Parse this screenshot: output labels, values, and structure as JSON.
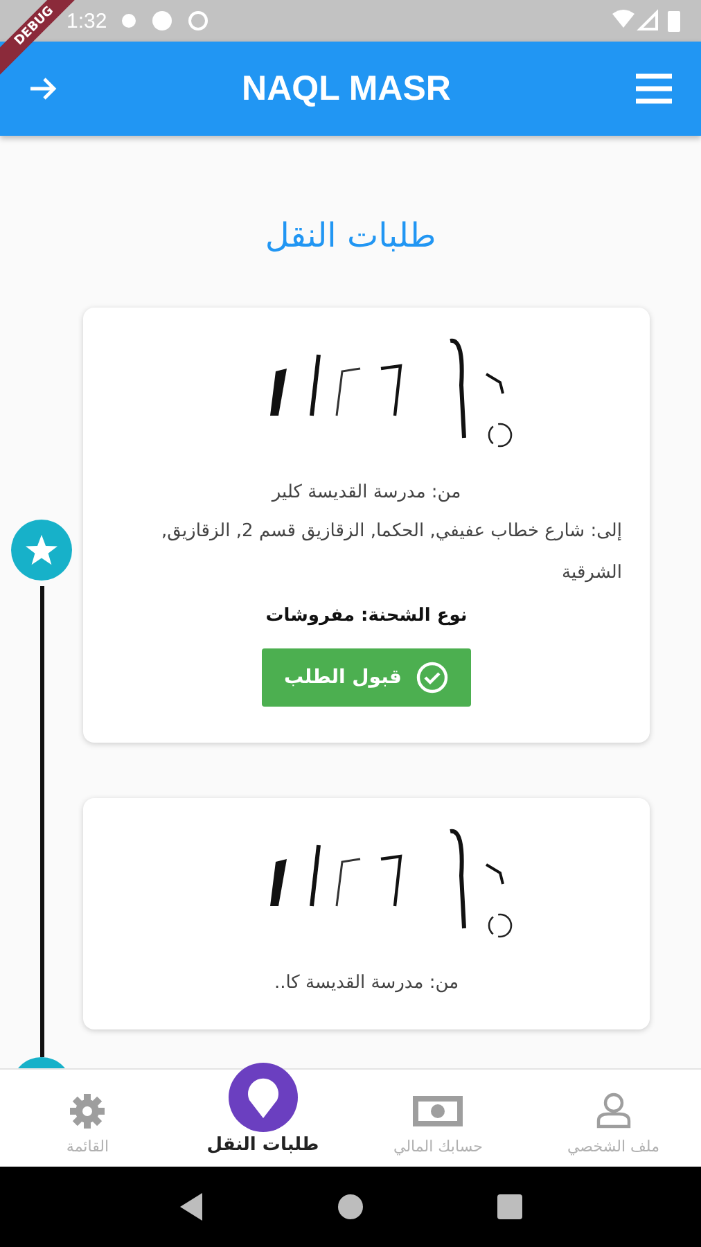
{
  "status_bar": {
    "time": "1:32"
  },
  "debug_banner": "DEBUG",
  "app_bar": {
    "title": "NAQL MASR"
  },
  "page_title": "طلبات النقل",
  "requests": [
    {
      "from": "من: مدرسة القديسة كلير",
      "to": "إلى: شارع خطاب عفيفي, الحكما, الزقازيق قسم 2, الزقازيق, الشرقية",
      "cargo": "نوع الشحنة: مفروشات",
      "accept_button": "قبول الطلب"
    },
    {
      "from": "من: مدرسة القديسة كا.."
    }
  ],
  "bottom_nav": [
    {
      "kind": "profile",
      "label": "ملف الشخصي",
      "selected": false
    },
    {
      "kind": "account",
      "label": "حسابك المالي",
      "selected": false
    },
    {
      "kind": "requests",
      "label": "طلبات النقل",
      "selected": true
    },
    {
      "kind": "menu",
      "label": "القائمة",
      "selected": false
    }
  ]
}
